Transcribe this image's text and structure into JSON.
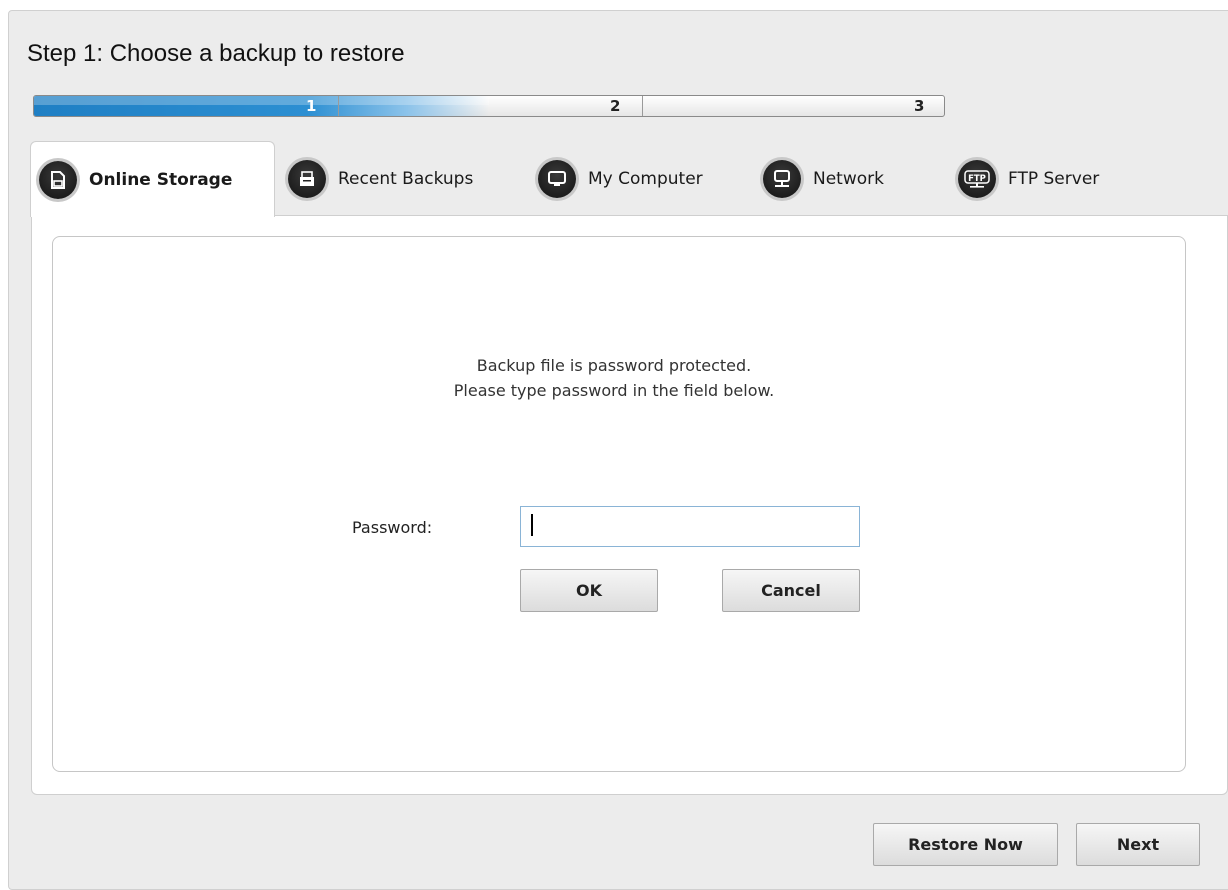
{
  "window": {
    "step_title": "Step 1: Choose a backup to restore"
  },
  "progress": {
    "steps": [
      "1",
      "2",
      "3"
    ],
    "active_step": 1,
    "fill_fraction": 0.5
  },
  "tabs": [
    {
      "label": "Online Storage",
      "icon": "online-storage-icon",
      "active": true
    },
    {
      "label": "Recent Backups",
      "icon": "recent-backups-icon",
      "active": false
    },
    {
      "label": "My Computer",
      "icon": "my-computer-icon",
      "active": false
    },
    {
      "label": "Network",
      "icon": "network-icon",
      "active": false
    },
    {
      "label": "FTP Server",
      "icon": "ftp-server-icon",
      "active": false
    }
  ],
  "icons": {
    "ftp_text": "FTP"
  },
  "panel": {
    "message_line1": "Backup file is password protected.",
    "message_line2": "Please type password in the field below.",
    "password_label": "Password:",
    "password_value": "",
    "ok_label": "OK",
    "cancel_label": "Cancel"
  },
  "footer": {
    "restore_now_label": "Restore Now",
    "next_label": "Next"
  },
  "colors": {
    "progress_blue": "#1f7fc4",
    "input_border": "#8ab4d6"
  }
}
